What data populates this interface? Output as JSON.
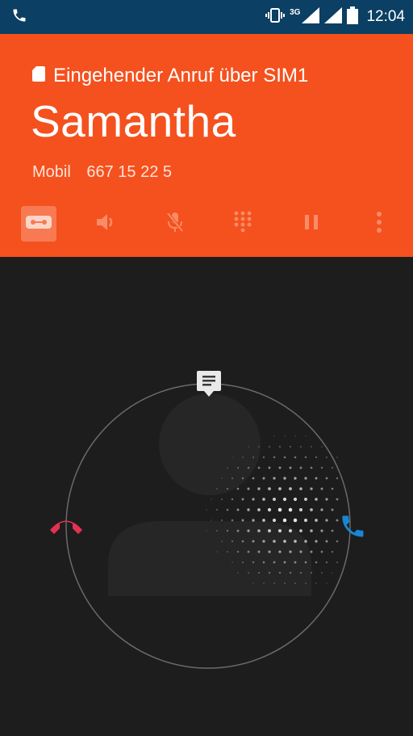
{
  "status_bar": {
    "time": "12:04",
    "network": "3G",
    "icons": [
      "phone-icon",
      "vibrate-icon",
      "signal-icon",
      "battery-icon"
    ],
    "background": "#0b3f63"
  },
  "call": {
    "incoming_label": "Eingehender Anruf über SIM1",
    "caller_name": "Samantha",
    "phone_type": "Mobil",
    "phone_number": "667 15 22 5",
    "header_color": "#f4511e"
  },
  "actions": [
    {
      "name": "voicemail",
      "icon": "voicemail-icon",
      "selected": true
    },
    {
      "name": "speaker",
      "icon": "speaker-icon"
    },
    {
      "name": "mute",
      "icon": "mic-off-icon"
    },
    {
      "name": "dialpad",
      "icon": "dialpad-icon"
    },
    {
      "name": "hold",
      "icon": "pause-icon"
    },
    {
      "name": "more",
      "icon": "more-vert-icon"
    }
  ],
  "answer_widget": {
    "decline_icon": "call-end-icon",
    "answer_icon": "call-icon",
    "message_icon": "message-icon",
    "decline_color": "#e53150",
    "answer_color": "#1786d6"
  }
}
